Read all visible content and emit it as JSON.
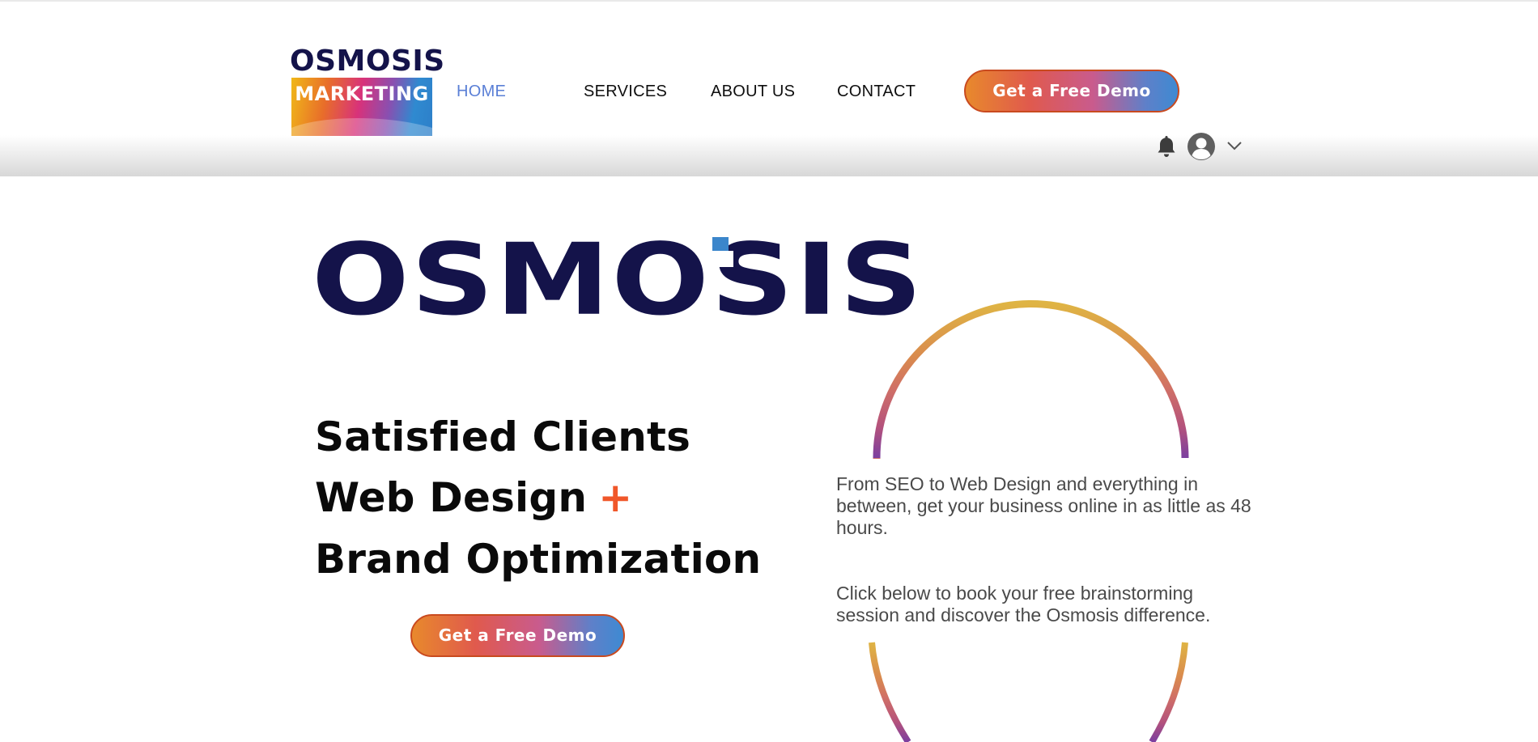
{
  "header": {
    "logo": {
      "line1": "OSMOSIS",
      "line2": "MARKETING"
    },
    "nav": [
      {
        "label": "HOME",
        "active": true
      },
      {
        "label": "SERVICES",
        "active": false
      },
      {
        "label": "ABOUT US",
        "active": false
      },
      {
        "label": "CONTACT",
        "active": false
      }
    ],
    "cta_label": "Get a Free Demo",
    "icons": [
      "bell-icon",
      "avatar-icon",
      "chevron-down-icon"
    ]
  },
  "hero": {
    "logo_word": "OSMOSIS",
    "headline": {
      "line1": "Satisfied Clients",
      "line2": "Web Design",
      "plus": "+",
      "line3": "Brand Optimization"
    },
    "cta_label": "Get a Free Demo",
    "paragraph1": "From SEO to Web Design and everything in between, get your business online in as little as 48 hours.",
    "paragraph2": "Click below to book your free brainstorming session and discover the Osmosis difference."
  },
  "colors": {
    "brand_navy": "#14134a",
    "nav_active": "#5a7fd6",
    "accent_orange": "#f0572a",
    "logo_square": "#3b86cb"
  }
}
